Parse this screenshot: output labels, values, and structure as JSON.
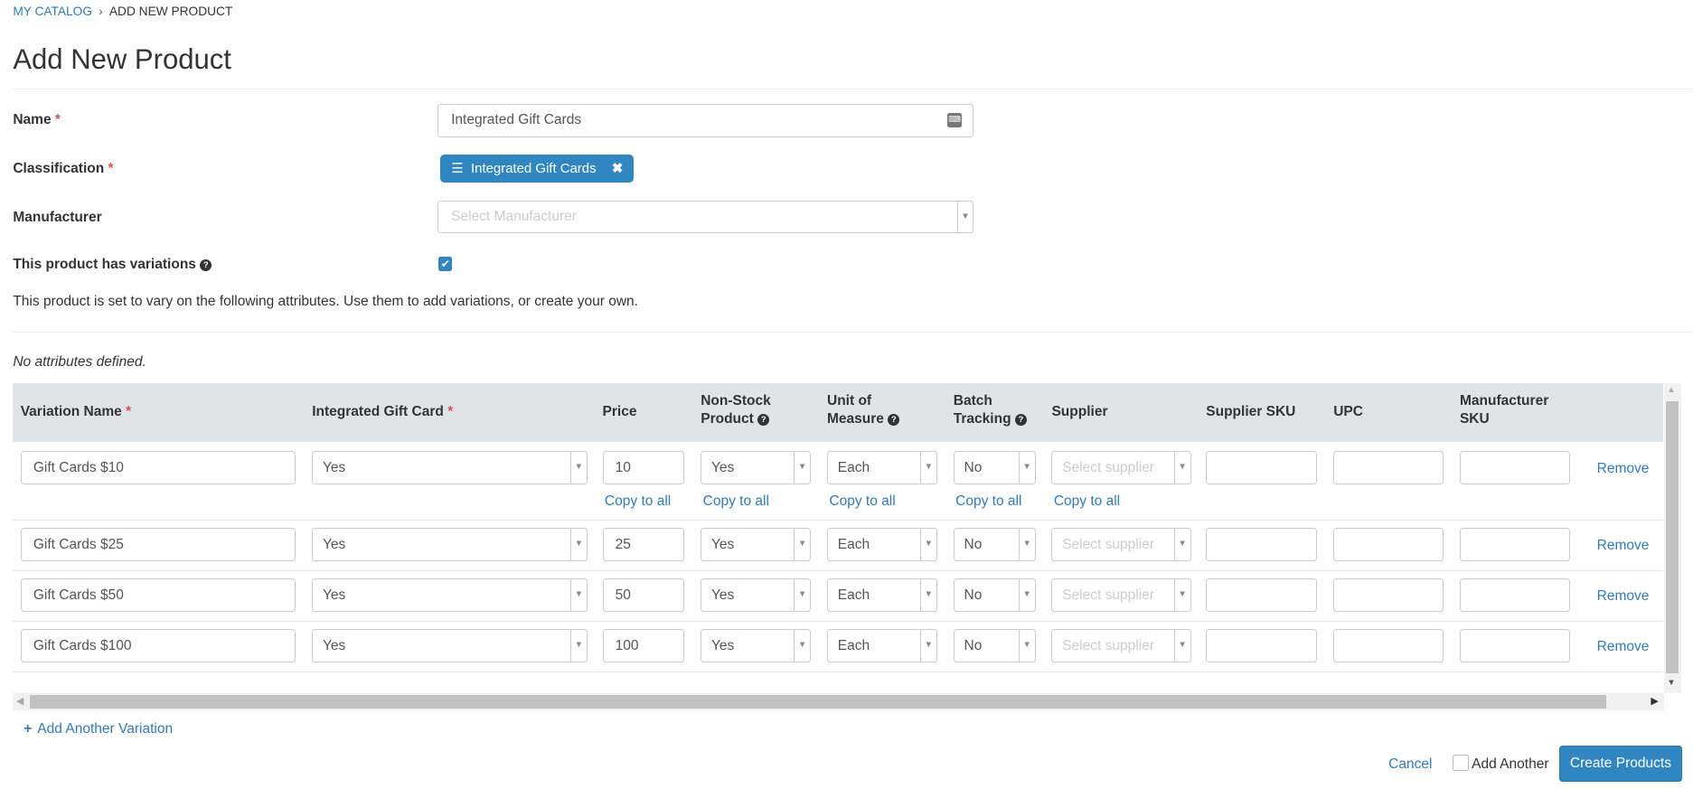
{
  "breadcrumb": {
    "root": "MY CATALOG",
    "current": "ADD NEW PRODUCT"
  },
  "page_title": "Add New Product",
  "form": {
    "name_label": "Name",
    "name_value": "Integrated Gift Cards",
    "classification_label": "Classification",
    "classification_chip": "Integrated Gift Cards",
    "manufacturer_label": "Manufacturer",
    "manufacturer_placeholder": "Select Manufacturer",
    "variations_label": "This product has variations",
    "variations_checked": true,
    "variations_help": "This product is set to vary on the following attributes. Use them to add variations, or create your own.",
    "no_attributes": "No attributes defined."
  },
  "table": {
    "headers": {
      "variation_name": "Variation Name",
      "gift_card": "Integrated Gift Card",
      "price": "Price",
      "non_stock_1": "Non-Stock",
      "non_stock_2": "Product",
      "uom_1": "Unit of",
      "uom_2": "Measure",
      "batch_1": "Batch",
      "batch_2": "Tracking",
      "supplier": "Supplier",
      "supplier_sku": "Supplier SKU",
      "upc": "UPC",
      "mfr_sku_1": "Manufacturer",
      "mfr_sku_2": "SKU"
    },
    "supplier_placeholder": "Select supplier",
    "copy_to_all": "Copy to all",
    "remove": "Remove",
    "rows": [
      {
        "name": "Gift Cards $10",
        "gift_card": "Yes",
        "price": "10",
        "non_stock": "Yes",
        "uom": "Each",
        "batch": "No"
      },
      {
        "name": "Gift Cards $25",
        "gift_card": "Yes",
        "price": "25",
        "non_stock": "Yes",
        "uom": "Each",
        "batch": "No"
      },
      {
        "name": "Gift Cards $50",
        "gift_card": "Yes",
        "price": "50",
        "non_stock": "Yes",
        "uom": "Each",
        "batch": "No"
      },
      {
        "name": "Gift Cards $100",
        "gift_card": "Yes",
        "price": "100",
        "non_stock": "Yes",
        "uom": "Each",
        "batch": "No"
      }
    ]
  },
  "add_variation": "Add Another Variation",
  "footer": {
    "cancel": "Cancel",
    "add_another": "Add Another",
    "create": "Create Products"
  },
  "colors": {
    "accent": "#2f86c1",
    "required": "#d9534f",
    "header_bg": "#e1e4e7"
  }
}
